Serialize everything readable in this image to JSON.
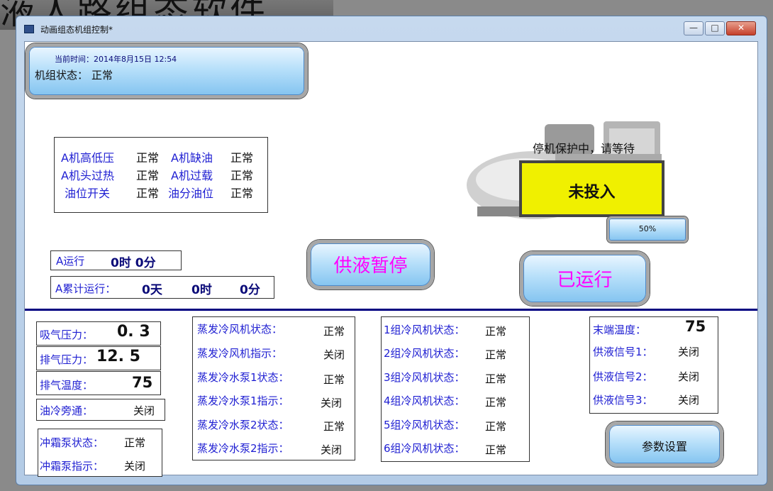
{
  "background": {
    "title": "液人路组态软件"
  },
  "window": {
    "title": "动画组态机组控制*",
    "min_label": "—",
    "max_label": "□",
    "close_label": "✕"
  },
  "header": {
    "time_label": "当前时间：2014年8月15日 12:54",
    "state_label": "机组状态：",
    "state_value": "正常"
  },
  "protection": {
    "labels": [
      [
        "A机高低压",
        "正常",
        "A机缺油",
        "正常"
      ],
      [
        "A机头过热",
        "正常",
        "A机过载",
        "正常"
      ],
      [
        "油位开关",
        "正常",
        "油分油位",
        "正常"
      ]
    ]
  },
  "runtime": {
    "a_run_label": "A运行",
    "a_run_value": "0时  0分",
    "a_total_label": "A累计运行：",
    "a_total_days": "0天",
    "a_total_hours": "0时",
    "a_total_mins": "0分"
  },
  "buttons": {
    "supply_pause": "供液暂停",
    "running": "已运行",
    "params": "参数设置"
  },
  "machine": {
    "protect_text": "停机保护中，请等待",
    "status": "未投入",
    "percent": "50%"
  },
  "pressures": {
    "suction_label": "吸气压力：",
    "suction_value": "0. 3",
    "discharge_label": "排气压力：",
    "discharge_value": "12. 5",
    "discharge_temp_label": "排气温度：",
    "discharge_temp_value": "75",
    "oil_bypass_label": "油冷旁通：",
    "oil_bypass_value": "关闭"
  },
  "defrost": {
    "state_label": "冲霜泵状态：",
    "state_value": "正常",
    "indicate_label": "冲霜泵指示：",
    "indicate_value": "关闭"
  },
  "evap": [
    [
      "蒸发冷风机状态：",
      "正常"
    ],
    [
      "蒸发冷风机指示：",
      "关闭"
    ],
    [
      "蒸发冷水泵1状态：",
      "正常"
    ],
    [
      "蒸发冷水泵1指示：",
      "关闭"
    ],
    [
      "蒸发冷水泵2状态：",
      "正常"
    ],
    [
      "蒸发冷水泵2指示：",
      "关闭"
    ]
  ],
  "groups": [
    [
      "1组冷风机状态：",
      "正常"
    ],
    [
      "2组冷风机状态：",
      "正常"
    ],
    [
      "3组冷风机状态：",
      "正常"
    ],
    [
      "4组冷风机状态：",
      "正常"
    ],
    [
      "5组冷风机状态：",
      "正常"
    ],
    [
      "6组冷风机状态：",
      "正常"
    ]
  ],
  "terminal": {
    "temp_label": "末端温度：",
    "temp_value": "75",
    "sig1_label": "供液信号1：",
    "sig1_value": "关闭",
    "sig2_label": "供液信号2：",
    "sig2_value": "关闭",
    "sig3_label": "供液信号3：",
    "sig3_value": "关闭"
  },
  "colors": {
    "label_blue": "#1e1ed2",
    "pause_magenta": "#ff00ff",
    "status_yellow": "#f0f000",
    "divider_navy": "#000080"
  }
}
